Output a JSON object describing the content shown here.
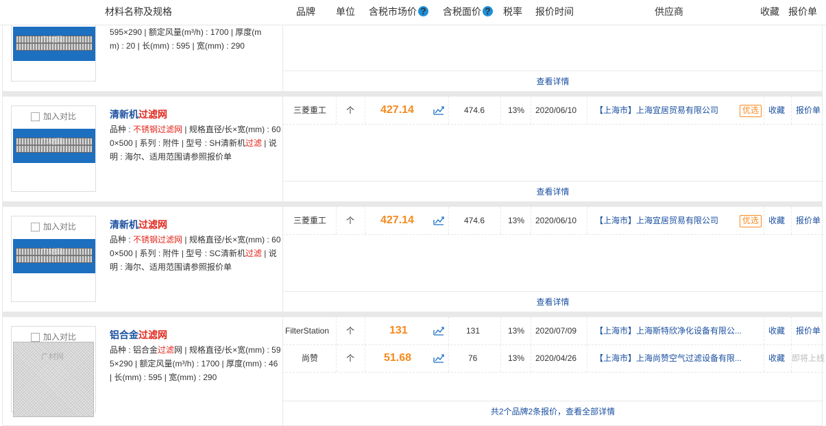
{
  "header": {
    "name_spec": "材料名称及规格",
    "brand": "品牌",
    "unit": "单位",
    "market_price": "含税市场价",
    "face_price": "含税面价",
    "tax": "税率",
    "quote_time": "报价时间",
    "supplier": "供应商",
    "favorite": "收藏",
    "quote_sheet": "报价单",
    "help_mark": "?"
  },
  "common": {
    "compare_label": "加入对比",
    "details_link": "查看详情",
    "best_badge": "优选",
    "favorite_link": "收藏",
    "quote_link": "报价单",
    "watermark": "广材网"
  },
  "row0": {
    "desc_line1": "595×290 | 额定风量(m³/h) : 1700 | 厚度(m",
    "desc_line2": "m) : 20 | 长(mm) : 595 | 宽(mm) : 290"
  },
  "row1": {
    "name_a": "清新机",
    "name_b": "过滤网",
    "desc_a": "品种 : ",
    "desc_b": "不锈钢过滤网",
    "desc_c": " | 规格直径/长×宽(mm) : 600×500 | 系列 : 附件 | 型号 : SH清新机",
    "desc_d": "过滤",
    "desc_e": " | 说明 : 海尔、适用范围请参照报价单",
    "brand": "三菱重工",
    "unit": "个",
    "price": "427.14",
    "face": "474.6",
    "tax": "13%",
    "date": "2020/06/10",
    "supplier": "【上海市】上海宜居贸易有限公司"
  },
  "row2": {
    "name_a": "清新机",
    "name_b": "过滤网",
    "desc_a": "品种 : ",
    "desc_b": "不锈钢过滤网",
    "desc_c": " | 规格直径/长×宽(mm) : 600×500 | 系列 : 附件 | 型号 : SC清新机",
    "desc_d": "过滤",
    "desc_e": " | 说明 : 海尔、适用范围请参照报价单",
    "brand": "三菱重工",
    "unit": "个",
    "price": "427.14",
    "face": "474.6",
    "tax": "13%",
    "date": "2020/06/10",
    "supplier": "【上海市】上海宜居贸易有限公司"
  },
  "row3": {
    "name_a": "铝合金",
    "name_b": "过滤网",
    "desc_a": "品种 : 铝合金",
    "desc_b": "过滤",
    "desc_c": "网 | 规格直径/长×宽(mm) : 595×290 | 额定风量(m³/h) : 1700 | 厚度(mm) : 46 | 长(mm) : 595 | 宽(mm) : 290",
    "quotes": [
      {
        "brand": "FilterStation",
        "unit": "个",
        "price": "131",
        "face": "131",
        "tax": "13%",
        "date": "2020/07/09",
        "supplier": "【上海市】上海斯特欣净化设备有限公...",
        "fav": "收藏",
        "quote": "报价单"
      },
      {
        "brand": "尚赞",
        "unit": "个",
        "price": "51.68",
        "face": "76",
        "tax": "13%",
        "date": "2020/04/26",
        "supplier": "【上海市】上海尚赞空气过滤设备有限...",
        "fav": "收藏",
        "quote": "即将上线"
      }
    ],
    "footer": "共2个品牌2条报价，查看全部详情"
  }
}
